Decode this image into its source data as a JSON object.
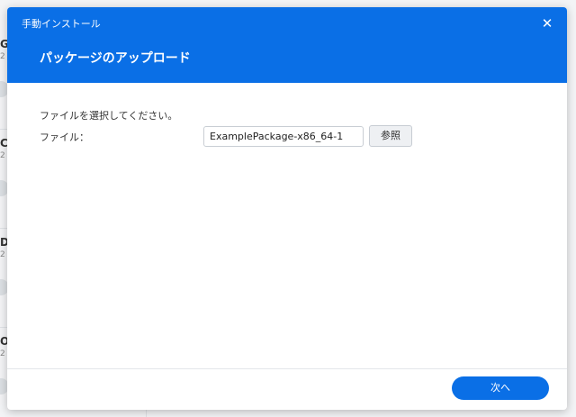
{
  "background": {
    "rows": [
      {
        "letter": "G",
        "sub": "2"
      },
      {
        "letter": "C",
        "sub": "2"
      },
      {
        "letter": "D",
        "sub": "2"
      },
      {
        "letter": "O",
        "sub": "2"
      }
    ]
  },
  "dialog": {
    "window_title": "手動インストール",
    "close_icon": "close-icon",
    "title": "パッケージのアップロード",
    "instruction": "ファイルを選択してください。",
    "file_label": "ファイル：",
    "file_value": "ExamplePackage-x86_64-1",
    "browse_label": "参照",
    "next_label": "次へ"
  },
  "colors": {
    "accent": "#0a6fe6",
    "header_text": "#ffffff"
  }
}
